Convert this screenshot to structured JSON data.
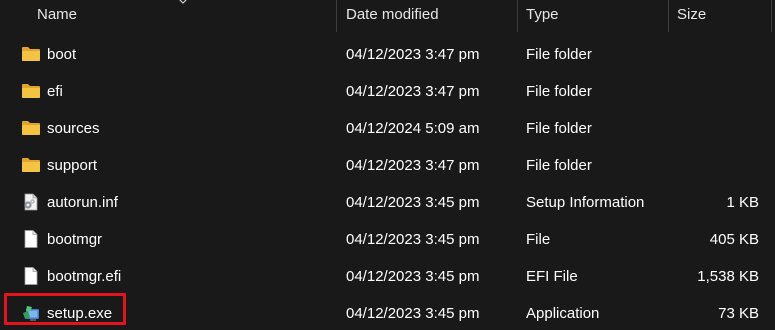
{
  "columns": {
    "name": "Name",
    "date_modified": "Date modified",
    "type": "Type",
    "size": "Size"
  },
  "files": [
    {
      "name": "boot",
      "date": "04/12/2023 3:47 pm",
      "type": "File folder",
      "size": "",
      "icon": "folder-icon"
    },
    {
      "name": "efi",
      "date": "04/12/2023 3:47 pm",
      "type": "File folder",
      "size": "",
      "icon": "folder-icon"
    },
    {
      "name": "sources",
      "date": "04/12/2024 5:09 am",
      "type": "File folder",
      "size": "",
      "icon": "folder-icon"
    },
    {
      "name": "support",
      "date": "04/12/2023 3:47 pm",
      "type": "File folder",
      "size": "",
      "icon": "folder-icon"
    },
    {
      "name": "autorun.inf",
      "date": "04/12/2023 3:45 pm",
      "type": "Setup Information",
      "size": "1 KB",
      "icon": "setup-info-file-icon"
    },
    {
      "name": "bootmgr",
      "date": "04/12/2023 3:45 pm",
      "type": "File",
      "size": "405 KB",
      "icon": "blank-file-icon"
    },
    {
      "name": "bootmgr.efi",
      "date": "04/12/2023 3:45 pm",
      "type": "EFI File",
      "size": "1,538 KB",
      "icon": "blank-file-icon"
    },
    {
      "name": "setup.exe",
      "date": "04/12/2023 3:45 pm",
      "type": "Application",
      "size": "73 KB",
      "icon": "setup-application-icon"
    }
  ],
  "colors": {
    "background": "#191919",
    "folder": "#f5c342",
    "highlight": "#e3141b"
  }
}
